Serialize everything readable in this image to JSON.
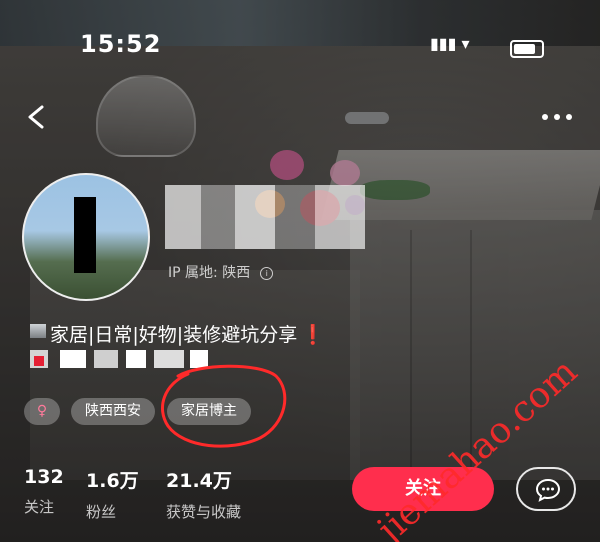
{
  "status_bar": {
    "time": "15:52"
  },
  "profile": {
    "ip_location": "IP 属地: 陕西",
    "bio": "家居|日常|好物|装修避坑分享",
    "bio_mark": "❗",
    "tags": {
      "gender": "♀",
      "location": "陕西西安",
      "role": "家居博主"
    }
  },
  "stats": {
    "following": {
      "value": "132",
      "label": "关注"
    },
    "fans": {
      "value": "1.6万",
      "label": "粉丝"
    },
    "likes": {
      "value": "21.4万",
      "label": "获赞与收藏"
    }
  },
  "actions": {
    "follow_label": "关注"
  },
  "watermark": "jiemahao.com",
  "colors": {
    "accent": "#ff2e4d",
    "annotation": "#ff2a2a"
  },
  "icons": {
    "back": "chevron-left-icon",
    "more": "more-dots-icon",
    "message": "chat-bubble-icon",
    "info": "info-icon"
  }
}
